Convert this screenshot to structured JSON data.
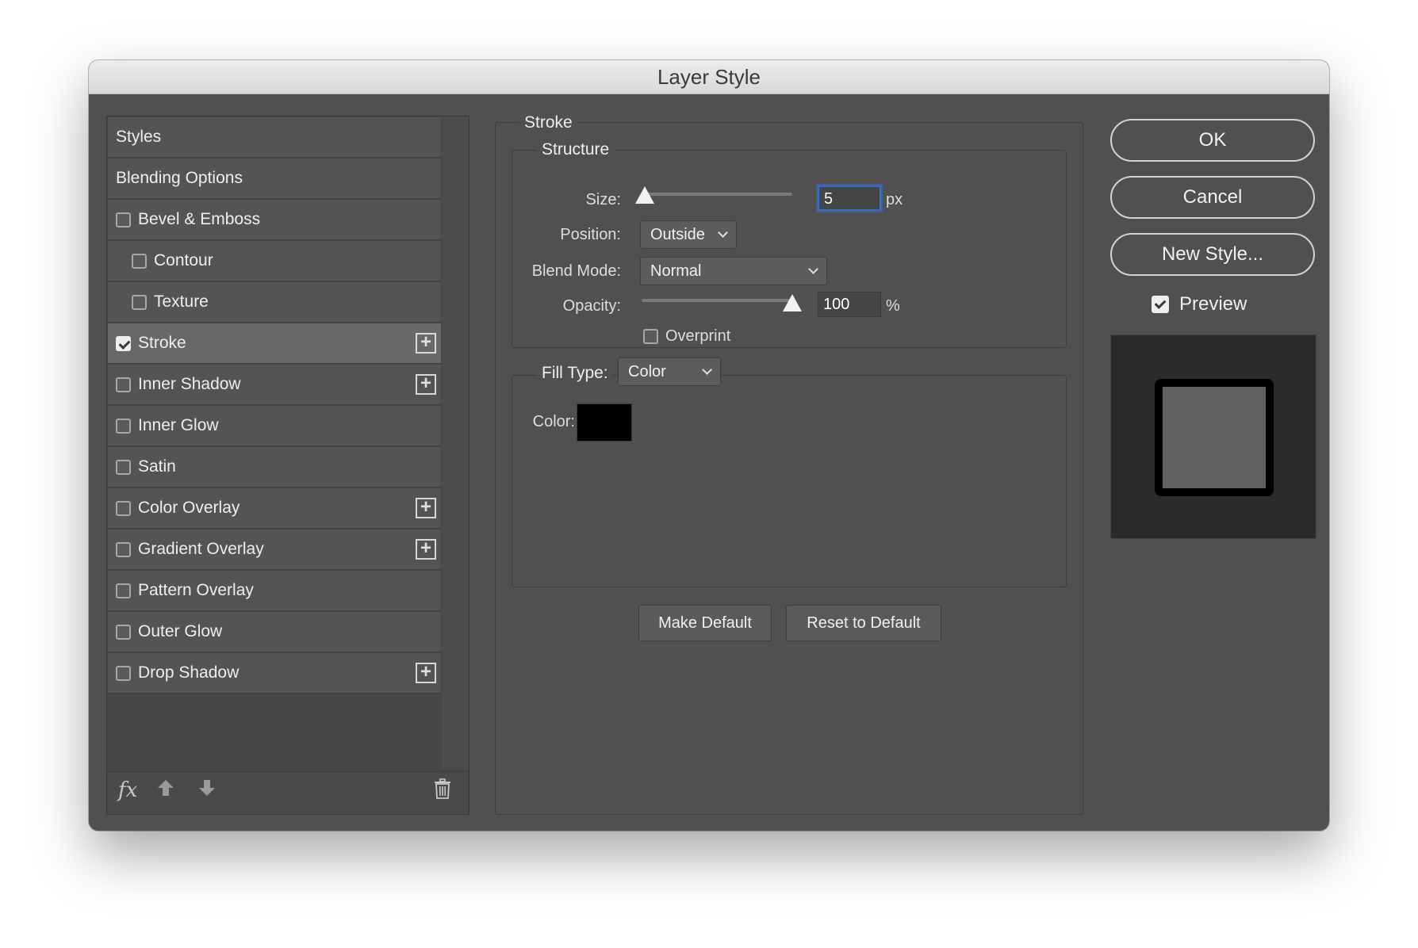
{
  "window": {
    "title": "Layer Style"
  },
  "styles_list": {
    "items": [
      {
        "label": "Styles",
        "has_checkbox": false,
        "checked": false,
        "indent": false,
        "has_plus": false,
        "selected": false
      },
      {
        "label": "Blending Options",
        "has_checkbox": false,
        "checked": false,
        "indent": false,
        "has_plus": false,
        "selected": false
      },
      {
        "label": "Bevel & Emboss",
        "has_checkbox": true,
        "checked": false,
        "indent": false,
        "has_plus": false,
        "selected": false
      },
      {
        "label": "Contour",
        "has_checkbox": true,
        "checked": false,
        "indent": true,
        "has_plus": false,
        "selected": false
      },
      {
        "label": "Texture",
        "has_checkbox": true,
        "checked": false,
        "indent": true,
        "has_plus": false,
        "selected": false
      },
      {
        "label": "Stroke",
        "has_checkbox": true,
        "checked": true,
        "indent": false,
        "has_plus": true,
        "selected": true
      },
      {
        "label": "Inner Shadow",
        "has_checkbox": true,
        "checked": false,
        "indent": false,
        "has_plus": true,
        "selected": false
      },
      {
        "label": "Inner Glow",
        "has_checkbox": true,
        "checked": false,
        "indent": false,
        "has_plus": false,
        "selected": false
      },
      {
        "label": "Satin",
        "has_checkbox": true,
        "checked": false,
        "indent": false,
        "has_plus": false,
        "selected": false
      },
      {
        "label": "Color Overlay",
        "has_checkbox": true,
        "checked": false,
        "indent": false,
        "has_plus": true,
        "selected": false
      },
      {
        "label": "Gradient Overlay",
        "has_checkbox": true,
        "checked": false,
        "indent": false,
        "has_plus": true,
        "selected": false
      },
      {
        "label": "Pattern Overlay",
        "has_checkbox": true,
        "checked": false,
        "indent": false,
        "has_plus": false,
        "selected": false
      },
      {
        "label": "Outer Glow",
        "has_checkbox": true,
        "checked": false,
        "indent": false,
        "has_plus": false,
        "selected": false
      },
      {
        "label": "Drop Shadow",
        "has_checkbox": true,
        "checked": false,
        "indent": false,
        "has_plus": true,
        "selected": false
      }
    ],
    "footer": {
      "fx_label": "fx",
      "icons": [
        "fx-menu-icon",
        "move-up-icon",
        "move-down-icon",
        "trash-icon"
      ]
    }
  },
  "stroke": {
    "section_title": "Stroke",
    "structure_title": "Structure",
    "size_label": "Size:",
    "size_value": "5",
    "size_unit": "px",
    "size_slider_fraction": 0.02,
    "position_label": "Position:",
    "position_value": "Outside",
    "blend_mode_label": "Blend Mode:",
    "blend_mode_value": "Normal",
    "opacity_label": "Opacity:",
    "opacity_value": "100",
    "opacity_unit": "%",
    "opacity_slider_fraction": 1.0,
    "overprint_label": "Overprint",
    "overprint_checked": false,
    "fill_type_label": "Fill Type:",
    "fill_type_value": "Color",
    "color_label": "Color:",
    "color_value": "#000000",
    "make_default_label": "Make Default",
    "reset_default_label": "Reset to Default"
  },
  "actions": {
    "ok_label": "OK",
    "cancel_label": "Cancel",
    "new_style_label": "New Style...",
    "preview_label": "Preview",
    "preview_checked": true
  },
  "colors": {
    "dialog_bg": "#505050",
    "focus_ring": "#2f6fd8",
    "preview_fill": "#616161",
    "stroke_color": "#000000"
  }
}
